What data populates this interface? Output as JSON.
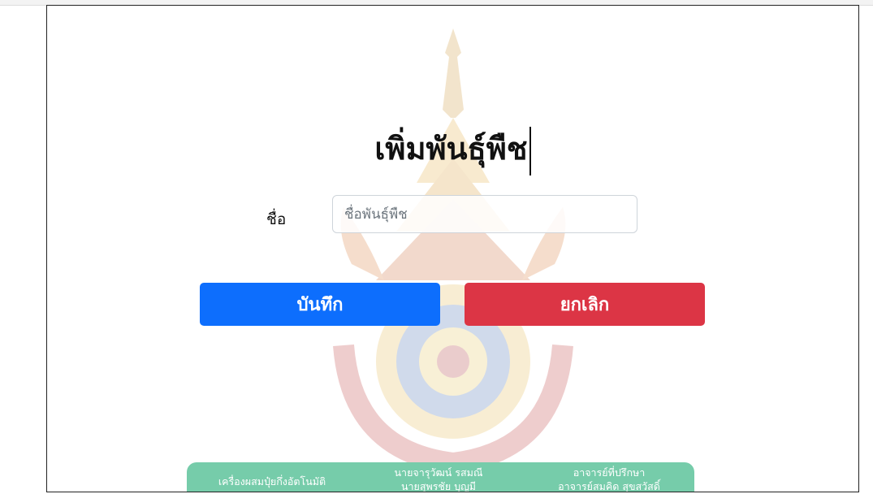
{
  "form": {
    "title": "เพิ่มพันธุ์พืช",
    "name_label": "ชื่อ",
    "name_placeholder": "ชื่อพันธุ์พืช",
    "name_value": ""
  },
  "buttons": {
    "save_label": "บันทึก",
    "cancel_label": "ยกเลิก"
  },
  "footer": {
    "project": "เครื่องผสมปุ๋ยกึ่งอัตโนมัติ",
    "authors": [
      "นายจารุวัฒน์ รสมณี",
      "นายสุพรชัย บุญมี"
    ],
    "advisor_label": "อาจารย์ที่ปรึกษา",
    "advisor_name": "อาจารย์สมคิด สุขสวัสดิ์"
  },
  "colors": {
    "save": "#0d6efd",
    "cancel": "#dc3545",
    "footer": "#76ccaa"
  }
}
